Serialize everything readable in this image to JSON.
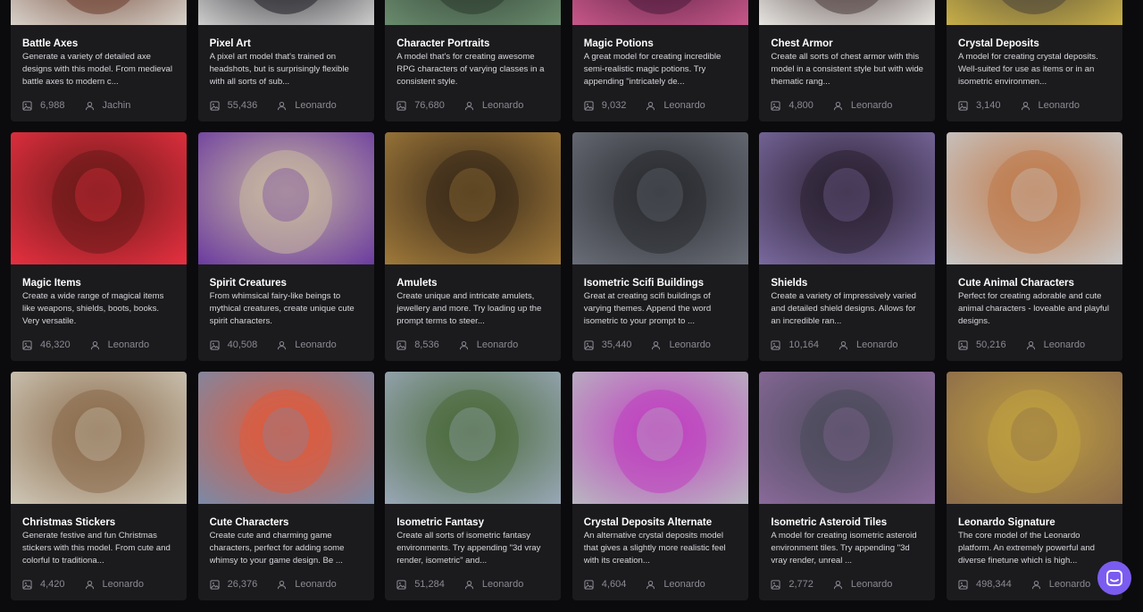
{
  "cards": [
    {
      "title": "Battle Axes",
      "desc": "Generate a variety of detailed axe designs with this model. From medieval battle axes to modern c...",
      "count": "6,988",
      "author": "Jachin",
      "colors": [
        "#d9d4cc",
        "#6a3a2a"
      ]
    },
    {
      "title": "Pixel Art",
      "desc": "A pixel art model that's trained on headshots, but is surprisingly flexible with all sorts of sub...",
      "count": "55,436",
      "author": "Leonardo",
      "colors": [
        "#cfcfcf",
        "#1c1c22"
      ]
    },
    {
      "title": "Character Portraits",
      "desc": "A model that's for creating awesome RPG characters of varying classes in a consistent style.",
      "count": "76,680",
      "author": "Leonardo",
      "colors": [
        "#6a8c6e",
        "#2c3a2e"
      ]
    },
    {
      "title": "Magic Potions",
      "desc": "A great model for creating incredible semi-realistic magic potions. Try appending \"intricately de...",
      "count": "9,032",
      "author": "Leonardo",
      "colors": [
        "#c9588a",
        "#4a1a3a"
      ]
    },
    {
      "title": "Chest Armor",
      "desc": "Create all sorts of chest armor with this model in a consistent style but with wide thematic rang...",
      "count": "4,800",
      "author": "Leonardo",
      "colors": [
        "#e8e6e2",
        "#4a3a3a"
      ]
    },
    {
      "title": "Crystal Deposits",
      "desc": "A model for creating crystal deposits. Well-suited for use as items or in an isometric environmen...",
      "count": "3,140",
      "author": "Leonardo",
      "colors": [
        "#c9b048",
        "#4a4338"
      ]
    },
    {
      "title": "Magic Items",
      "desc": "Create a wide range of magical items like weapons, shields, boots, books. Very versatile.",
      "count": "46,320",
      "author": "Leonardo",
      "colors": [
        "#e83040",
        "#6a1a1a"
      ]
    },
    {
      "title": "Spirit Creatures",
      "desc": "From whimsical fairy-like beings to mythical creatures, create unique cute spirit characters.",
      "count": "40,508",
      "author": "Leonardo",
      "colors": [
        "#6a3aa0",
        "#c9b8a0"
      ]
    },
    {
      "title": "Amulets",
      "desc": "Create unique and intricate amulets, jewellery and more. Try loading up the prompt terms to steer...",
      "count": "8,536",
      "author": "Leonardo",
      "colors": [
        "#a07a3a",
        "#3a2a1a"
      ]
    },
    {
      "title": "Isometric Scifi Buildings",
      "desc": "Great at creating scifi buildings of varying themes. Append the word isometric to your prompt to ...",
      "count": "35,440",
      "author": "Leonardo",
      "colors": [
        "#6a6e78",
        "#2a2c30"
      ]
    },
    {
      "title": "Shields",
      "desc": "Create a variety of impressively varied and detailed shield designs. Allows for an incredible ran...",
      "count": "10,164",
      "author": "Leonardo",
      "colors": [
        "#7a6aa0",
        "#2a2030"
      ]
    },
    {
      "title": "Cute Animal Characters",
      "desc": "Perfect for creating adorable and cute animal characters - loveable and playful designs.",
      "count": "50,216",
      "author": "Leonardo",
      "colors": [
        "#c8c8c8",
        "#c07a4a"
      ]
    },
    {
      "title": "Christmas Stickers",
      "desc": "Generate festive and fun Christmas stickers with this model. From cute and colorful to traditiona...",
      "count": "4,420",
      "author": "Leonardo",
      "colors": [
        "#cfc8b8",
        "#8a6a4a"
      ]
    },
    {
      "title": "Cute Characters",
      "desc": "Create cute and charming game characters, perfect for adding some whimsy to your game design. Be ...",
      "count": "26,376",
      "author": "Leonardo",
      "colors": [
        "#7a8aa8",
        "#e05a3a"
      ]
    },
    {
      "title": "Isometric Fantasy",
      "desc": "Create all sorts of isometric fantasy environments. Try appending \"3d vray render, isometric\" and...",
      "count": "51,284",
      "author": "Leonardo",
      "colors": [
        "#9aa8b8",
        "#4a6a3a"
      ]
    },
    {
      "title": "Crystal Deposits Alternate",
      "desc": "An alternative crystal deposits model that gives a slightly more realistic feel with its creation...",
      "count": "4,604",
      "author": "Leonardo",
      "colors": [
        "#b8b8c0",
        "#c040c0"
      ]
    },
    {
      "title": "Isometric Asteroid Tiles",
      "desc": "A model for creating isometric asteroid environment tiles. Try appending \"3d vray render, unreal ...",
      "count": "2,772",
      "author": "Leonardo",
      "colors": [
        "#8a6a9a",
        "#4a4a5a"
      ]
    },
    {
      "title": "Leonardo Signature",
      "desc": "The core model of the Leonardo platform. An extremely powerful and diverse finetune which is high...",
      "count": "498,344",
      "author": "Leonardo",
      "colors": [
        "#8a6a4a",
        "#c0a040"
      ]
    }
  ],
  "icons": {
    "image": "image-icon",
    "user": "user-icon",
    "chat": "chat-icon"
  }
}
